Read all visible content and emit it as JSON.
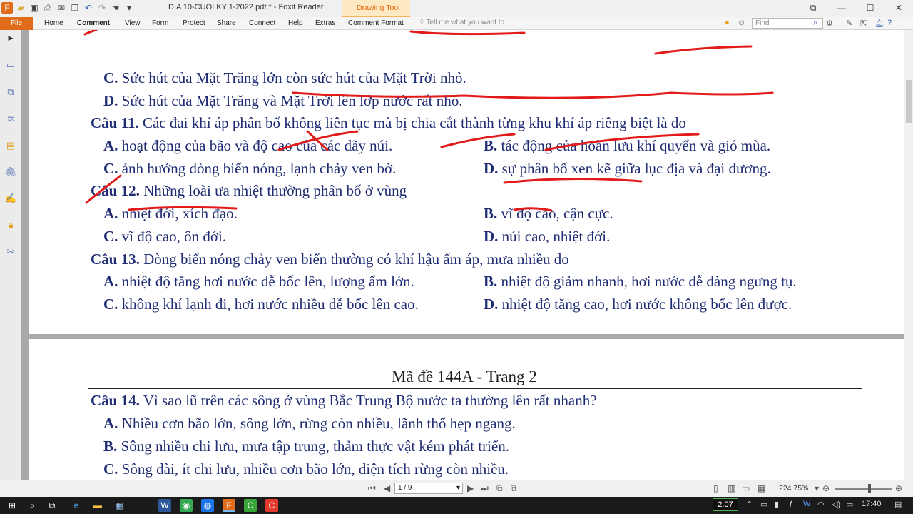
{
  "window": {
    "title": "DIA 10-CUOI KY 1-2022.pdf * - Foxit Reader",
    "context_tab": "Drawing Tool",
    "accent_color": "#e06c1a"
  },
  "ribbon": {
    "file": "File",
    "menus": [
      "Home",
      "Comment",
      "View",
      "Form",
      "Protect",
      "Share",
      "Connect",
      "Help",
      "Extras",
      "Comment Format"
    ],
    "tell_me": "Tell me what you want to",
    "find_placeholder": "Find"
  },
  "page1": {
    "lines": [
      {
        "label": "C.",
        "text": " Sức hút của Mặt Trăng lớn còn sức hút của Mặt Trời nhỏ."
      },
      {
        "label": "D.",
        "text": " Sức hút của Mặt Trăng và Mặt Trời lên lớp nước rất nhỏ."
      },
      {
        "label": "Câu 11.",
        "text": " Các đai khí áp phân bố không liên tục mà bị chia cắt thành từng khu khí áp riêng biệt là do"
      },
      {
        "label": "A.",
        "text": " hoạt động của bão và độ cao của các dãy núi."
      },
      {
        "label": "B.",
        "text": " tác động của hoàn lưu khí quyển và gió mùa."
      },
      {
        "label": "C.",
        "text": " ảnh hưởng dòng biển nóng, lạnh chảy ven bờ."
      },
      {
        "label": "D.",
        "text": " sự phân bố xen kẽ giữa lục địa và đại dương."
      },
      {
        "label": "Câu 12.",
        "text": " Những loài ưa nhiệt thường phân bố ở vùng"
      },
      {
        "label": "A.",
        "text": " nhiệt đới, xích đạo."
      },
      {
        "label": "B.",
        "text": " vĩ độ cao, cận cực."
      },
      {
        "label": "C.",
        "text": " vĩ độ cao, ôn đới."
      },
      {
        "label": "D.",
        "text": " núi cao, nhiệt đới."
      },
      {
        "label": "Câu 13.",
        "text": " Dòng biển nóng chảy ven biển thường có khí hậu ấm áp, mưa nhiều do"
      },
      {
        "label": "A.",
        "text": " nhiệt độ tăng hơi nước dễ bốc lên, lượng ẩm lớn."
      },
      {
        "label": "B.",
        "text": " nhiệt độ giảm nhanh, hơi nước dễ dàng ngưng tụ."
      },
      {
        "label": "C.",
        "text": " không khí lạnh đi, hơi nước nhiều dễ bốc lên cao."
      },
      {
        "label": "D.",
        "text": " nhiệt độ tăng cao, hơi nước không bốc lên được."
      }
    ]
  },
  "page2": {
    "header": "Mã đề 144A - Trang 2",
    "lines": [
      {
        "label": "Câu 14.",
        "text": " Vì sao lũ trên các sông ở vùng Bắc Trung Bộ nước ta thường lên rất nhanh?"
      },
      {
        "label": "A.",
        "text": " Nhiều cơn bão lớn, sông lớn, rừng còn nhiều, lãnh thổ hẹp ngang."
      },
      {
        "label": "B.",
        "text": " Sông nhiều chi lưu, mưa tập trung, thảm thực vật kém phát triển."
      },
      {
        "label": "C.",
        "text": " Sông dài, ít chi lưu, nhiều cơn bão lớn, diện tích rừng còn nhiều."
      }
    ]
  },
  "status": {
    "page": "1 / 9",
    "zoom": "224.75%"
  },
  "taskbar": {
    "timer": "2:07",
    "clock": "17:40"
  }
}
